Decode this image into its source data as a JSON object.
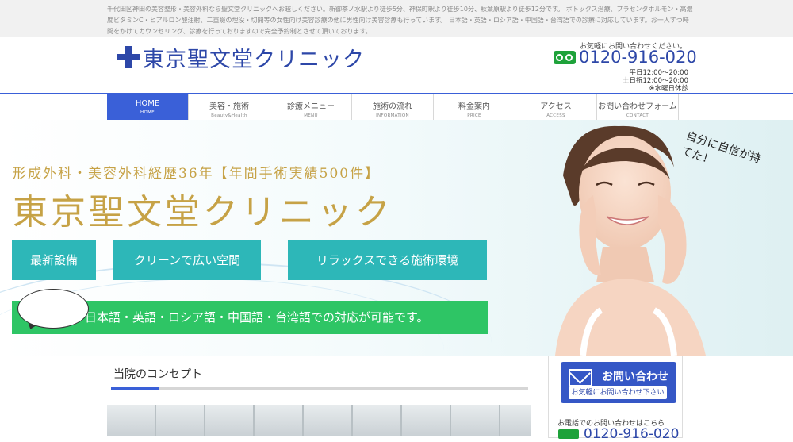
{
  "topbar": {
    "text": "千代田区神田の美容整形・美容外科なら聖文堂クリニックへお越しください。新御茶ノ水駅より徒歩5分、神保町駅より徒歩10分、秋葉原駅より徒歩12分です。 ボトックス治療、プラセンタホルモン・高濃度ビタミンC・ヒアルロン酸注射、二重瞼の埋没・切開等の女性向け美容診療の他に男性向け美容診療も行っています。 日本語・英語・ロシア語・中国語・台湾語での診療に対応しています。お一人ずつ時間をかけてカウンセリング、診療を行っておりますので完全予約制とさせて頂いております。"
  },
  "header": {
    "logo_text": "東京聖文堂クリニック",
    "contact_note": "お気軽にお問い合わせください。",
    "phone": "0120-916-020",
    "hours": [
      "平日12:00〜20:00",
      "土日祝12:00〜20:00",
      "※水曜日休診"
    ]
  },
  "nav": [
    {
      "label": "HOME",
      "sub": "HOME"
    },
    {
      "label": "美容・施術",
      "sub": "Beauty&Health"
    },
    {
      "label": "診療メニュー",
      "sub": "MENU"
    },
    {
      "label": "施術の流れ",
      "sub": "INFORMATION"
    },
    {
      "label": "料金案内",
      "sub": "PRICE"
    },
    {
      "label": "アクセス",
      "sub": "ACCESS"
    },
    {
      "label": "お問い合わせフォーム",
      "sub": "CONTACT"
    }
  ],
  "hero": {
    "subtitle": "形成外科・美容外科経歴36年【年間手術実績500件】",
    "title": "東京聖文堂クリニック",
    "features": [
      "最新設備",
      "クリーンで広い空間",
      "リラックスできる施術環境"
    ],
    "languages": "日本語・英語・ロシア語・中国語・台湾語での対応が可能です。",
    "speech": "自分に自信が持てた！"
  },
  "main": {
    "concept_heading": "当院のコンセプト"
  },
  "sidebar": {
    "inquiry_title": "お問い合わせ",
    "inquiry_sub": "お気軽にお問い合わせ下さい",
    "tel_note": "お電話でのお問い合わせはこちら",
    "phone": "0120-916-020"
  },
  "colors": {
    "brand_blue": "#2d47a8",
    "nav_active": "#3a60d8",
    "gold": "#c6a246",
    "teal": "#2db7b8",
    "green": "#2ec565",
    "freedial_green": "#1ea23a"
  }
}
